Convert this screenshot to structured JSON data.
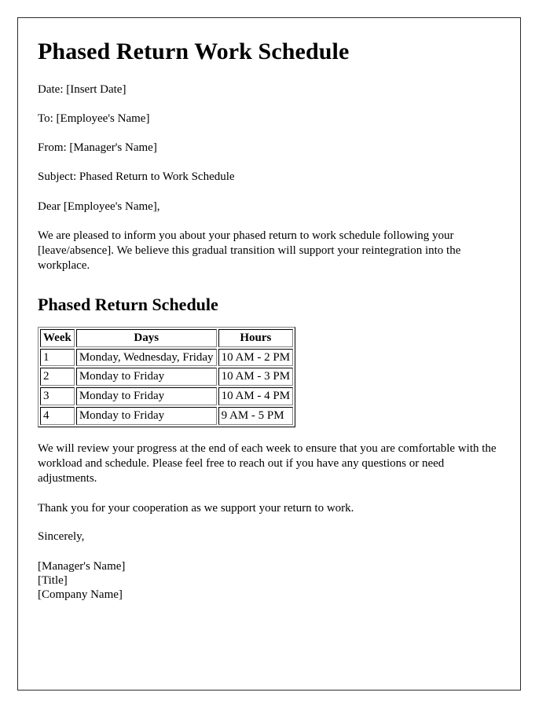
{
  "document": {
    "title": "Phased Return Work Schedule",
    "header_lines": [
      "Date: [Insert Date]",
      "To: [Employee's Name]",
      "From: [Manager's Name]",
      "Subject: Phased Return to Work Schedule"
    ],
    "salutation": "Dear [Employee's Name],",
    "intro_paragraph": "We are pleased to inform you about your phased return to work schedule following your [leave/absence]. We believe this gradual transition will support your reintegration into the workplace.",
    "schedule_section": {
      "heading": "Phased Return Schedule",
      "table": {
        "columns": [
          "Week",
          "Days",
          "Hours"
        ],
        "rows": [
          [
            "1",
            "Monday, Wednesday, Friday",
            "10 AM - 2 PM"
          ],
          [
            "2",
            "Monday to Friday",
            "10 AM - 3 PM"
          ],
          [
            "3",
            "Monday to Friday",
            "10 AM - 4 PM"
          ],
          [
            "4",
            "Monday to Friday",
            "9 AM - 5 PM"
          ]
        ]
      }
    },
    "review_paragraph": "We will review your progress at the end of each week to ensure that you are comfortable with the workload and schedule. Please feel free to reach out if you have any questions or need adjustments.",
    "thanks_paragraph": "Thank you for your cooperation as we support your return to work.",
    "closing": "Sincerely,",
    "signature_lines": [
      "[Manager's Name]",
      "[Title]",
      "[Company Name]"
    ]
  },
  "style": {
    "text_color": "#000000",
    "page_background": "#ffffff",
    "border_color": "#2b2b2b",
    "table_border_color": "#2f2f2f"
  }
}
